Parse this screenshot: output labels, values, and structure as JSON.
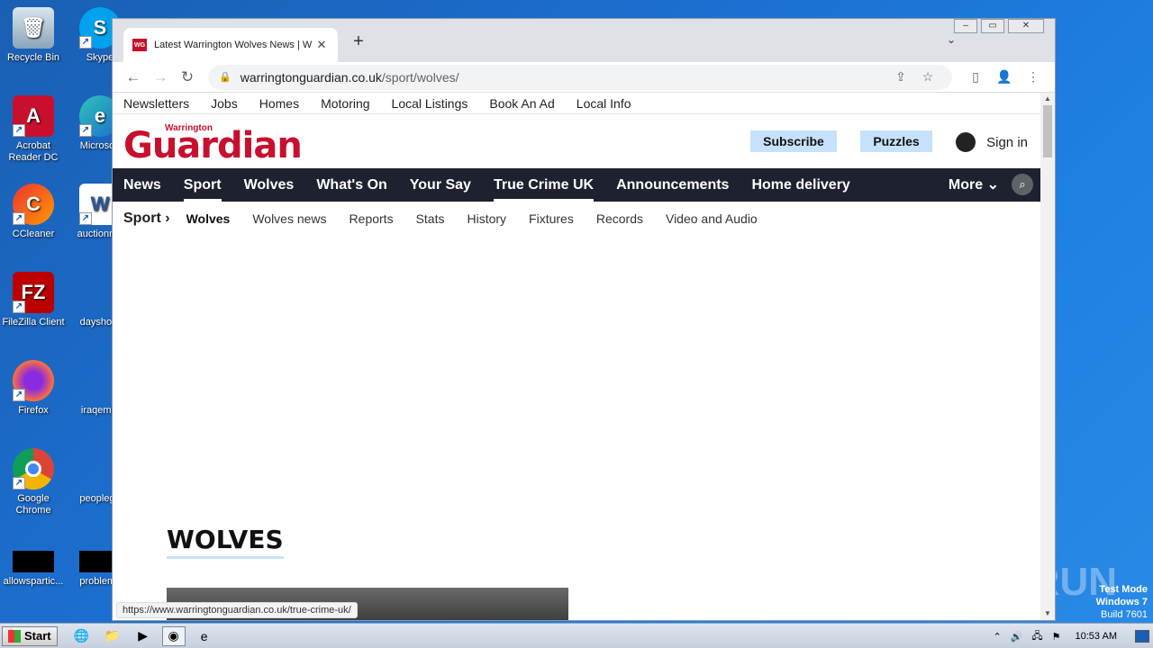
{
  "desktop": {
    "icons": [
      {
        "label": "Recycle Bin"
      },
      {
        "label": "Skype"
      },
      {
        "label": "Acrobat Reader DC"
      },
      {
        "label": "Microsoft"
      },
      {
        "label": "CCleaner"
      },
      {
        "label": "auctionme"
      },
      {
        "label": "FileZilla Client"
      },
      {
        "label": "dayshop."
      },
      {
        "label": "Firefox"
      },
      {
        "label": "iraqempl"
      },
      {
        "label": "Google Chrome"
      },
      {
        "label": "peoplege"
      },
      {
        "label": "allowspartic..."
      },
      {
        "label": "problems"
      }
    ]
  },
  "browser": {
    "tab": {
      "favicon": "WG",
      "title": "Latest Warrington Wolves News | W",
      "close": "✕"
    },
    "new_tab": "+",
    "url": {
      "host": "warringtonguardian.co.uk",
      "path": "/sport/wolves/"
    },
    "status_url": "https://www.warringtonguardian.co.uk/true-crime-uk/"
  },
  "site": {
    "util_nav": [
      "Newsletters",
      "Jobs",
      "Homes",
      "Motoring",
      "Local Listings",
      "Book An Ad",
      "Local Info"
    ],
    "logo_small": "Warrington",
    "logo_big": "Guardian",
    "subscribe": "Subscribe",
    "puzzles": "Puzzles",
    "sign_in": "Sign in",
    "main_nav": [
      "News",
      "Sport",
      "Wolves",
      "What's On",
      "Your Say",
      "True Crime UK",
      "Announcements",
      "Home delivery"
    ],
    "more": "More",
    "sub_section": "Sport",
    "sub_nav": [
      "Wolves",
      "Wolves news",
      "Reports",
      "Stats",
      "History",
      "Fixtures",
      "Records",
      "Video and Audio"
    ],
    "heading": "WOLVES"
  },
  "taskbar": {
    "start": "Start",
    "clock": "10:53 AM"
  },
  "watermark": {
    "brand": "ANY RUN",
    "line1": "Test Mode",
    "line2": "Windows 7",
    "line3": "Build 7601"
  }
}
